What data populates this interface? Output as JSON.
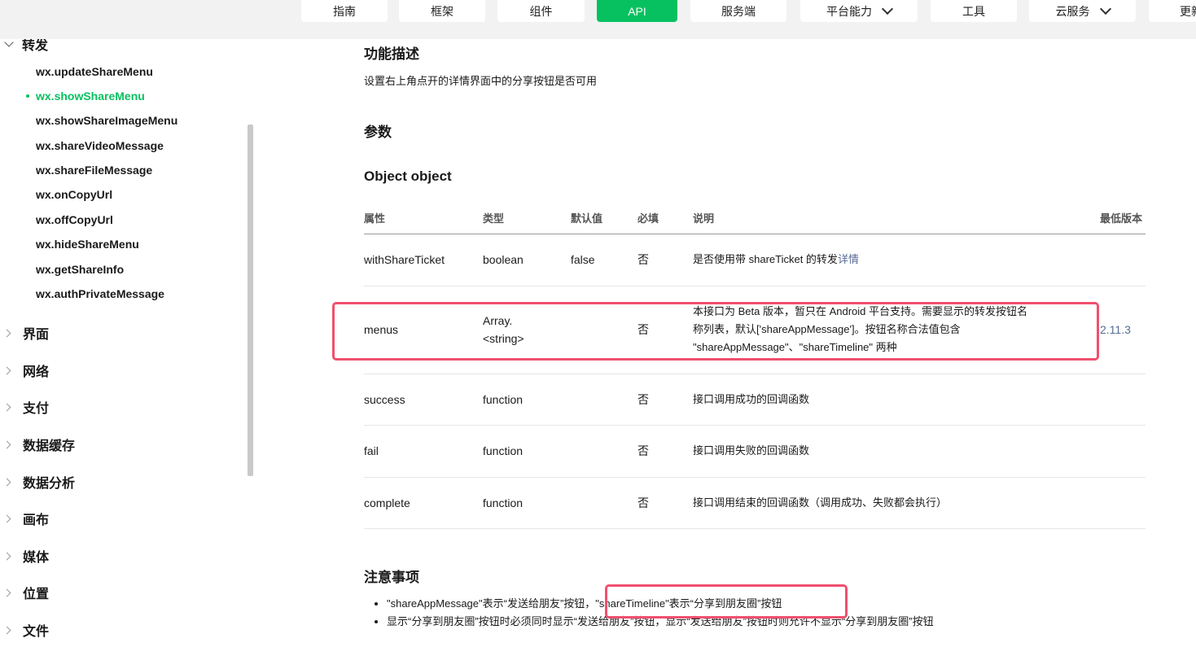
{
  "nav": {
    "items": [
      {
        "label": "指南"
      },
      {
        "label": "框架"
      },
      {
        "label": "组件"
      },
      {
        "label": "API",
        "active": true
      },
      {
        "label": "服务端"
      },
      {
        "label": "平台能力",
        "dropdown": true
      },
      {
        "label": "工具"
      },
      {
        "label": "云服务",
        "dropdown": true
      },
      {
        "label": "更新"
      }
    ]
  },
  "sidebar": {
    "open_section": "转发",
    "sub_items": [
      "wx.updateShareMenu",
      "wx.showShareMenu",
      "wx.showShareImageMenu",
      "wx.shareVideoMessage",
      "wx.shareFileMessage",
      "wx.onCopyUrl",
      "wx.offCopyUrl",
      "wx.hideShareMenu",
      "wx.getShareInfo",
      "wx.authPrivateMessage"
    ],
    "active_sub_item": "wx.showShareMenu",
    "sections": [
      "界面",
      "网络",
      "支付",
      "数据缓存",
      "数据分析",
      "画布",
      "媒体",
      "位置",
      "文件"
    ]
  },
  "content": {
    "func_title": "功能描述",
    "func_desc": "设置右上角点开的详情界面中的分享按钮是否可用",
    "params_title": "参数",
    "object_title": "Object object",
    "table": {
      "headers": [
        "属性",
        "类型",
        "默认值",
        "必填",
        "说明",
        "最低版本"
      ],
      "rows": [
        {
          "name": "withShareTicket",
          "type": "boolean",
          "default": "false",
          "required": "否",
          "desc": "是否使用带 shareTicket 的转发",
          "desc_link": "详情",
          "version": ""
        },
        {
          "name": "menus",
          "type_line1": "Array.",
          "type_line2": "<string>",
          "default": "",
          "required": "否",
          "desc_line1": "本接口为 Beta 版本，暂只在 Android 平台支持。需要显示的转发按钮名",
          "desc_line2": "称列表，默认['shareAppMessage']。按钮名称合法值包含",
          "desc_line3": "\"shareAppMessage\"、\"shareTimeline\" 两种",
          "version": "2.11.3"
        },
        {
          "name": "success",
          "type": "function",
          "default": "",
          "required": "否",
          "desc": "接口调用成功的回调函数",
          "version": ""
        },
        {
          "name": "fail",
          "type": "function",
          "default": "",
          "required": "否",
          "desc": "接口调用失败的回调函数",
          "version": ""
        },
        {
          "name": "complete",
          "type": "function",
          "default": "",
          "required": "否",
          "desc": "接口调用结束的回调函数（调用成功、失败都会执行）",
          "version": ""
        }
      ]
    },
    "notes_title": "注意事项",
    "notes": [
      "\"shareAppMessage\"表示“发送给朋友”按钮，\"shareTimeline\"表示“分享到朋友圈”按钮",
      "显示“分享到朋友圈”按钮时必须同时显示“发送给朋友”按钮，显示“发送给朋友”按钮时则允许不显示“分享到朋友圈”按钮"
    ]
  },
  "colors": {
    "accent": "#07c160",
    "link": "#576b95",
    "highlight_box": "#f0506e"
  }
}
